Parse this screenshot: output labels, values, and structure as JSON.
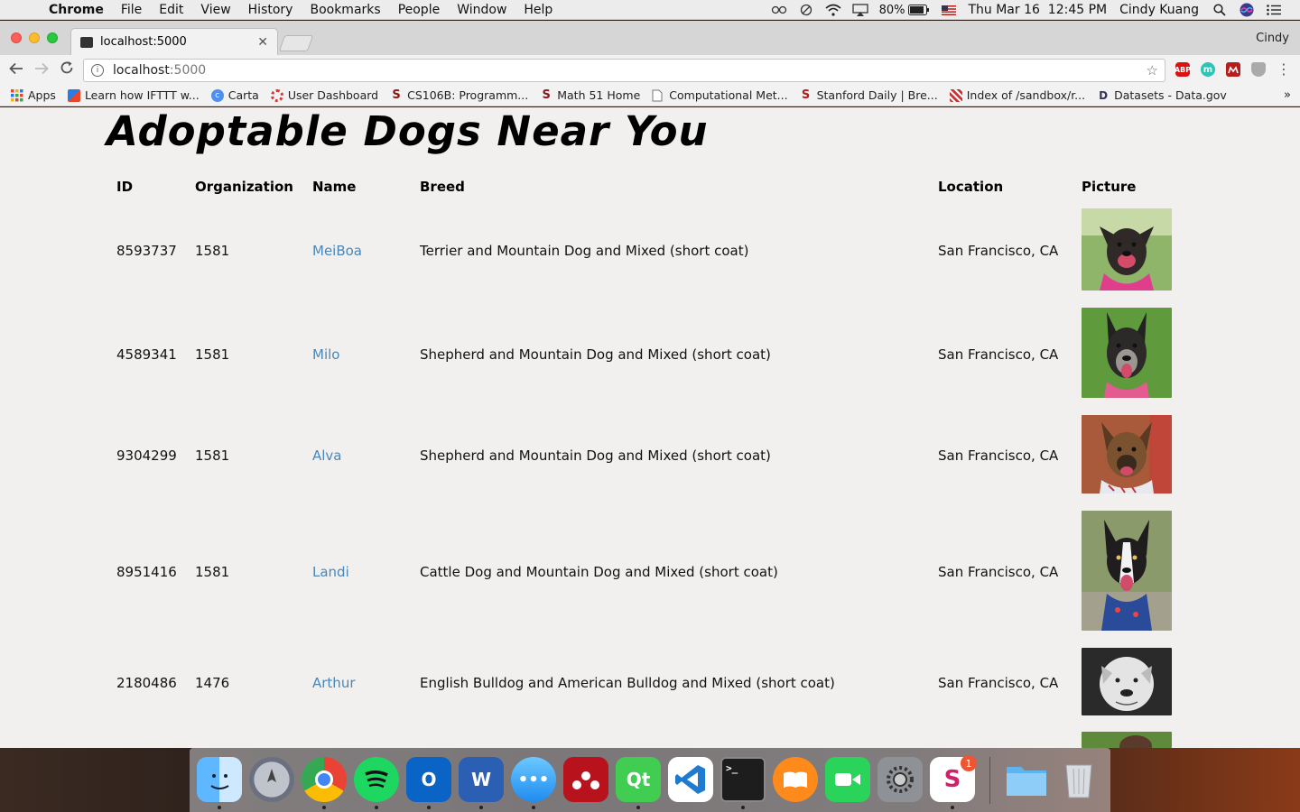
{
  "menubar": {
    "app": "Chrome",
    "items": [
      "File",
      "Edit",
      "View",
      "History",
      "Bookmarks",
      "People",
      "Window",
      "Help"
    ],
    "battery": "80%",
    "datetime": "Thu Mar 16  12:45 PM",
    "user": "Cindy Kuang"
  },
  "browser": {
    "tab_title": "localhost:5000",
    "profile": "Cindy",
    "url_host": "localhost",
    "url_port": ":5000",
    "ext_labels": [
      "ABP",
      "m",
      ""
    ]
  },
  "bookmarks": [
    {
      "label": "Apps",
      "color": "#e8462b"
    },
    {
      "label": "Learn how IFTTT w...",
      "color": "#2a7be4"
    },
    {
      "label": "Carta",
      "color": "#4f8ff0"
    },
    {
      "label": "User Dashboard",
      "color": "#d33"
    },
    {
      "label": "CS106B: Programm...",
      "color": "#8c1515"
    },
    {
      "label": "Math 51 Home",
      "color": "#8c1515"
    },
    {
      "label": "Computational Met...",
      "color": "#aaaaaa"
    },
    {
      "label": "Stanford Daily | Bre...",
      "color": "#b31b1b"
    },
    {
      "label": "Index of /sandbox/r...",
      "color": "#c33"
    },
    {
      "label": "Datasets - Data.gov",
      "color": "#335"
    }
  ],
  "page": {
    "title": "Adoptable Dogs Near You",
    "columns": [
      "ID",
      "Organization",
      "Name",
      "Breed",
      "Location",
      "Picture"
    ],
    "rows": [
      {
        "id": "8593737",
        "org": "1581",
        "name": "MeiBoa",
        "breed": "Terrier and Mountain Dog and Mixed (short coat)",
        "location": "San Francisco, CA"
      },
      {
        "id": "4589341",
        "org": "1581",
        "name": "Milo",
        "breed": "Shepherd and Mountain Dog and Mixed (short coat)",
        "location": "San Francisco, CA"
      },
      {
        "id": "9304299",
        "org": "1581",
        "name": "Alva",
        "breed": "Shepherd and Mountain Dog and Mixed (short coat)",
        "location": "San Francisco, CA"
      },
      {
        "id": "8951416",
        "org": "1581",
        "name": "Landi",
        "breed": "Cattle Dog and Mountain Dog and Mixed (short coat)",
        "location": "San Francisco, CA"
      },
      {
        "id": "2180486",
        "org": "1476",
        "name": "Arthur",
        "breed": "English Bulldog and American Bulldog and Mixed (short coat)",
        "location": "San Francisco, CA"
      }
    ]
  },
  "dock": [
    "finder-icon",
    "launchpad-icon",
    "chrome-icon",
    "spotify-icon",
    "outlook-icon",
    "word-icon",
    "messages-icon",
    "mendeley-icon",
    "qt-icon",
    "vscode-icon",
    "terminal-icon",
    "ibooks-icon",
    "facetime-icon",
    "system-preferences-icon",
    "slack-icon",
    "folder-icon",
    "trash-icon"
  ],
  "dock_badge": "1",
  "dock_labels": {
    "qt": "Qt",
    "slack": "S"
  }
}
